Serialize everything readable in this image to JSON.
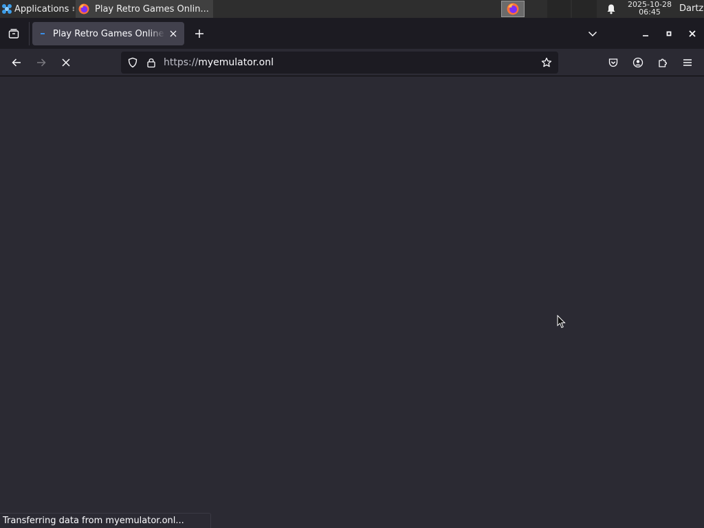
{
  "taskbar": {
    "applications_label": "Applications",
    "task_title": "Play Retro Games Onlin...",
    "clock_date": "2025-10-28",
    "clock_time": "06:45",
    "user": "Dartz"
  },
  "browser": {
    "tab": {
      "title": "Play Retro Games Online"
    },
    "url": {
      "scheme": "https://",
      "host": "myemulator.onl"
    },
    "status_text": "Transferring data from myemulator.onl..."
  },
  "icons": {
    "applications": "xfce-mouse-icon",
    "firefox": "firefox-icon",
    "bell": "bell-icon",
    "tab_manager": "tab-manager-icon",
    "new_tab": "plus-icon",
    "list_tabs": "chevron-down-icon",
    "minimize": "minimize-icon",
    "maximize": "maximize-icon",
    "close": "close-icon",
    "back": "back-arrow-icon",
    "forward": "forward-arrow-icon",
    "stop": "stop-icon",
    "tracking": "shield-icon",
    "lock": "lock-icon",
    "bookmark": "star-icon",
    "pocket": "pocket-icon",
    "account": "account-icon",
    "extensions": "puzzle-icon",
    "menu": "hamburger-menu-icon"
  },
  "colors": {
    "content_bg": "#2b2a33",
    "tabstrip_bg": "#1c1b22",
    "active_tab_bg": "#42414d",
    "loading_accent": "#3a8ee6"
  }
}
